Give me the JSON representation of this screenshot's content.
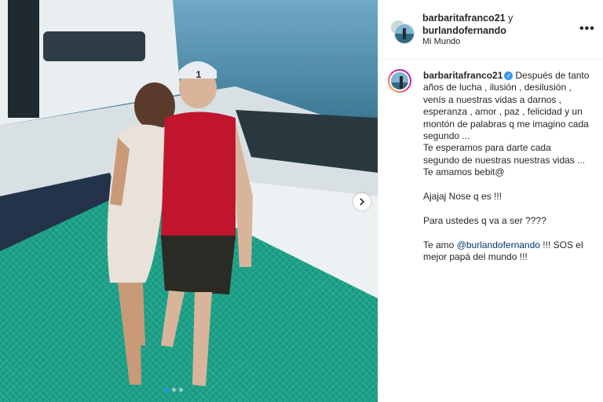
{
  "post": {
    "image": {
      "alt_icons": [
        "next-arrow-icon"
      ],
      "carousel_dots": 3,
      "active_dot": 0,
      "cap_number": "1"
    },
    "header": {
      "user1": "barbaritafranco21",
      "joiner": "y",
      "user2": "burlandofernando",
      "location": "Mi Mundo",
      "more_label": "•••"
    },
    "caption": {
      "username": "barbaritafranco21",
      "verified_icon": "verified-badge-icon",
      "verified_glyph": "✓",
      "paragraph1": "Después de tanto años de lucha , ilusión , desilusión , venís a nuestras vidas a darnos , esperanza , amor , paz , felicidad y un montón de palabras q me imagino cada segundo ...",
      "paragraph2": "Te esperamos para darte cada segundo de nuestras nuestras vidas ... Te amamos bebit@",
      "line3": "Ajajaj Nose q es !!!",
      "line4": "Para ustedes q va a ser ????",
      "line5_pre": "Te amo ",
      "line5_mention": "@burlandofernando",
      "line5_post": " !!! SOS el mejor papá del mundo !!!"
    },
    "colors": {
      "accent": "#3897f0",
      "mention": "#00376b",
      "text": "#262626",
      "net": "#1fa08a"
    }
  }
}
